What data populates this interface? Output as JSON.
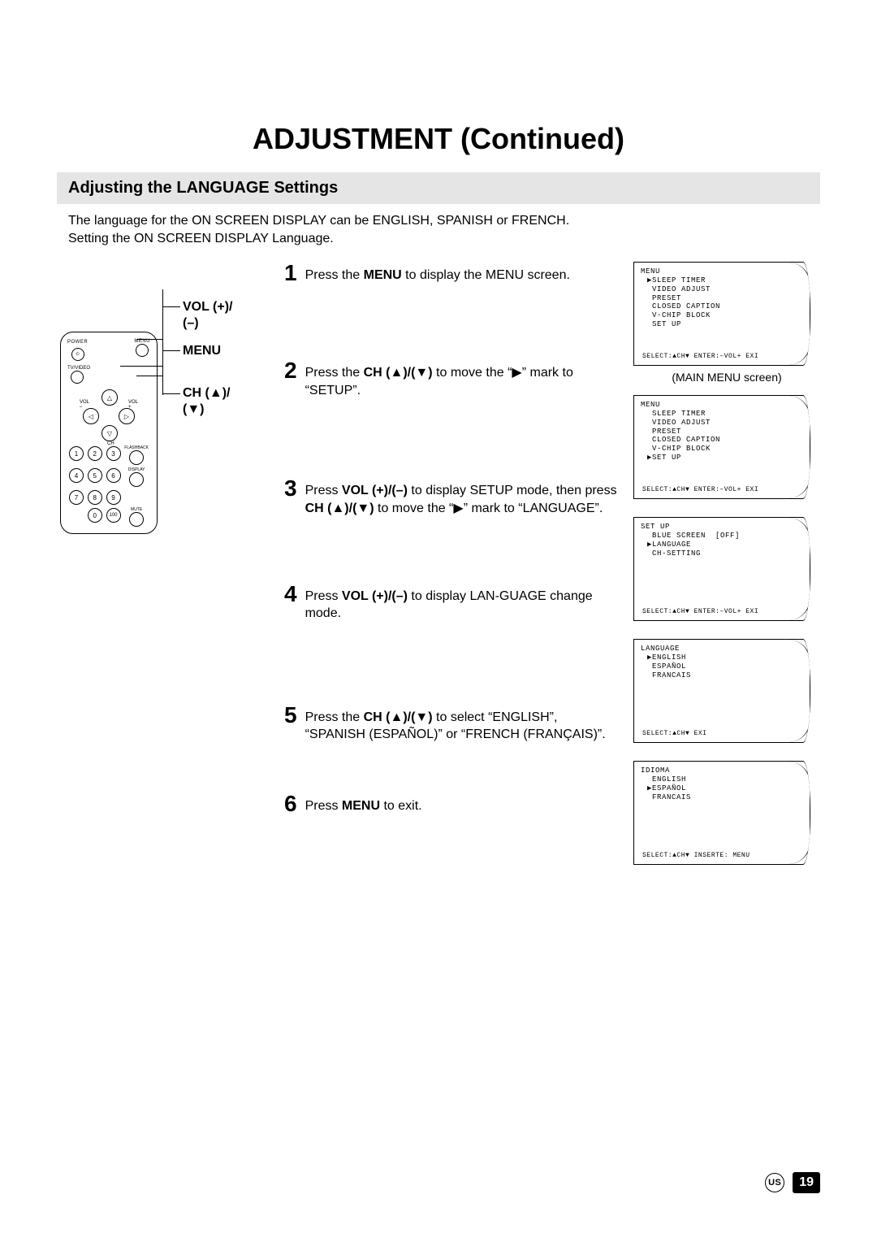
{
  "page_title": "ADJUSTMENT (Continued)",
  "section_title": "Adjusting the LANGUAGE Settings",
  "intro_line1": "The language for the ON SCREEN DISPLAY can be ENGLISH, SPANISH or FRENCH.",
  "intro_line2": "Setting the ON SCREEN DISPLAY Language.",
  "remote_labels": {
    "vol": "VOL (+)/",
    "vol2": "(–)",
    "menu": "MENU",
    "ch": "CH (▲)/",
    "ch2": "(▼)"
  },
  "remote_small": {
    "power": "POWER",
    "menu": "MENU",
    "tvvideo": "TV/VIDEO",
    "vol_l": "VOL\n–",
    "vol_r": "VOL\n+",
    "ch": "CH",
    "flashback": "FLASHBACK",
    "display": "DISPLAY",
    "mute": "MUTE"
  },
  "steps": {
    "s1": {
      "n": "1",
      "a": "Press the ",
      "b": "MENU",
      "c": " to display the MENU screen."
    },
    "s2": {
      "n": "2",
      "a": "Press the ",
      "b": "CH (▲)/(▼)",
      "c": " to move the “▶” mark to “SETUP”."
    },
    "s3": {
      "n": "3",
      "a": "Press ",
      "b": "VOL (+)/(–)",
      "c": " to display SETUP mode, then press ",
      "d": "CH (▲)/(▼)",
      "e": " to move the “▶” mark to “LANGUAGE”."
    },
    "s4": {
      "n": "4",
      "a": "Press ",
      "b": "VOL (+)/(–)",
      "c": " to display LAN-GUAGE change mode."
    },
    "s5": {
      "n": "5",
      "a": "Press the ",
      "b": "CH (▲)/(▼)",
      "c": " to select “ENGLISH”, “SPANISH (ESPAÑOL)” or “FRENCH  (FRANÇAIS)”."
    },
    "s6": {
      "n": "6",
      "a": "Press ",
      "b": "MENU",
      "c": " to exit."
    }
  },
  "screens": {
    "s1": {
      "title": "MENU",
      "lines": [
        "▶SLEEP TIMER",
        " VIDEO ADJUST",
        " PRESET",
        " CLOSED CAPTION",
        " V-CHIP BLOCK",
        " SET UP"
      ],
      "footer": "SELECT:▲CH▼ ENTER:–VOL+  EXI",
      "caption": "(MAIN MENU screen)"
    },
    "s2": {
      "title": "MENU",
      "lines": [
        " SLEEP TIMER",
        " VIDEO ADJUST",
        " PRESET",
        " CLOSED CAPTION",
        " V-CHIP BLOCK",
        "▶SET UP"
      ],
      "footer": "SELECT:▲CH▼ ENTER:–VOL+  EXI"
    },
    "s3": {
      "title": "SET UP",
      "lines": [
        " BLUE SCREEN  [OFF]",
        "▶LANGUAGE",
        " CH-SETTING"
      ],
      "footer": "SELECT:▲CH▼  ENTER:–VOL+ EXI"
    },
    "s4": {
      "title": "LANGUAGE",
      "lines": [
        "▶ENGLISH",
        " ESPAÑOL",
        " FRANCAIS"
      ],
      "footer": "SELECT:▲CH▼             EXI"
    },
    "s5": {
      "title": "IDIOMA",
      "lines": [
        " ENGLISH",
        "▶ESPAÑOL",
        " FRANCAIS"
      ],
      "footer": "SELECT:▲CH▼  INSERTE: MENU"
    }
  },
  "footer": {
    "region": "US",
    "page": "19"
  }
}
